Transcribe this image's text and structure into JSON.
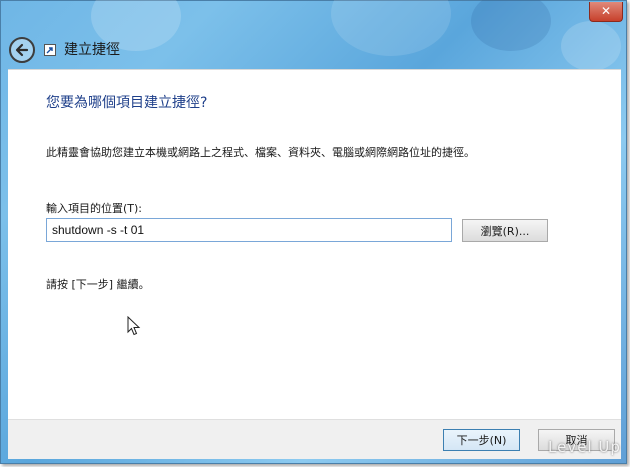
{
  "window": {
    "title": "建立捷徑",
    "close_label": "✕",
    "back_icon": "back-arrow-icon",
    "accent_color": "#1e3f8a",
    "close_color": "#c7402c"
  },
  "main": {
    "heading": "您要為哪個項目建立捷徑?",
    "description": "此精靈會協助您建立本機或網路上之程式、檔案、資料夾、電腦或網際網路位址的捷徑。",
    "location_label": "輸入項目的位置(T):",
    "location_value": "shutdown -s -t 01",
    "browse_label": "瀏覽(R)...",
    "hint": "請按 [下一步] 繼續。"
  },
  "footer": {
    "next_label": "下一步(N)",
    "cancel_label": "取消"
  },
  "watermark": {
    "text": "Level Up"
  }
}
